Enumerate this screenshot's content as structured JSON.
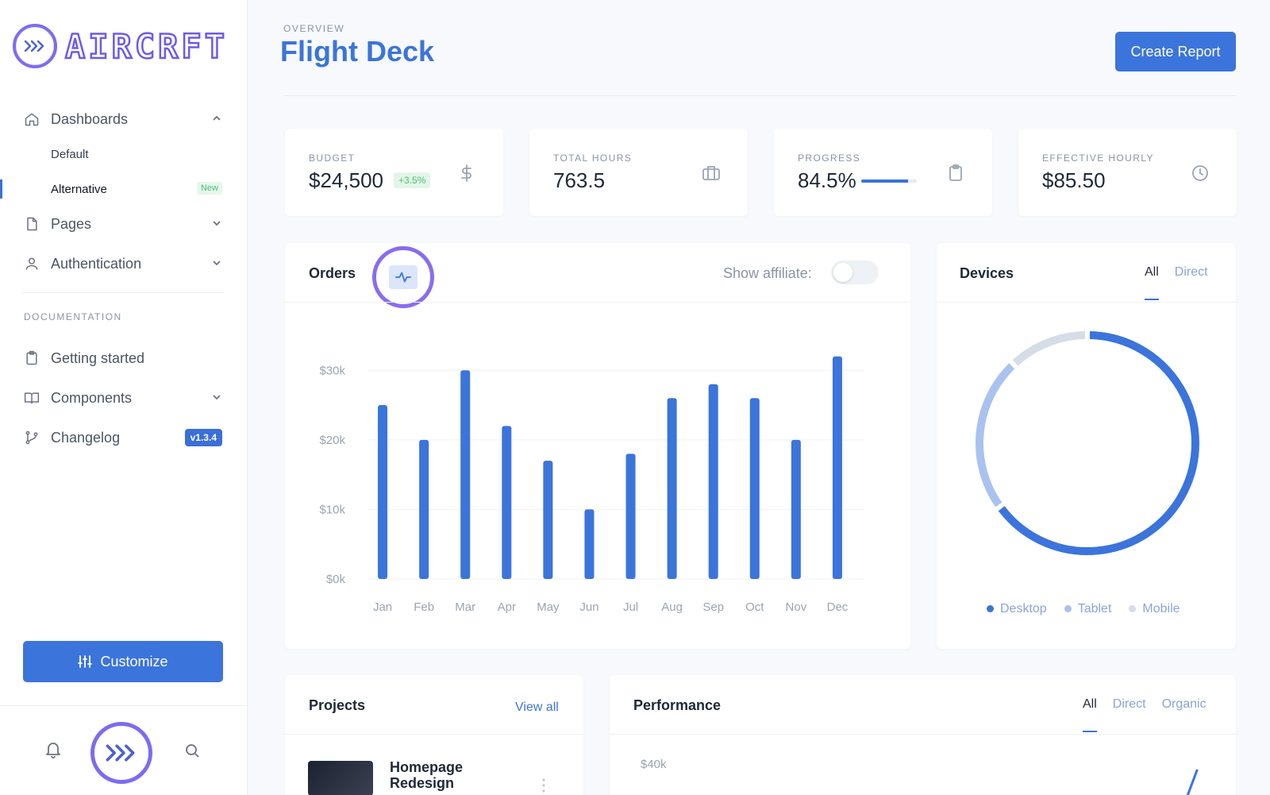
{
  "app": {
    "logo_text": "AIRCRFT"
  },
  "sidebar": {
    "nav": [
      {
        "label": "Dashboards",
        "icon": "home-icon",
        "expanded": true
      },
      {
        "label": "Pages",
        "icon": "file-icon"
      },
      {
        "label": "Authentication",
        "icon": "user-icon"
      }
    ],
    "sub_items": [
      {
        "label": "Default"
      },
      {
        "label": "Alternative",
        "badge": "New",
        "active": true
      }
    ],
    "section_label": "DOCUMENTATION",
    "docs": [
      {
        "label": "Getting started",
        "icon": "clipboard-icon"
      },
      {
        "label": "Components",
        "icon": "book-icon"
      },
      {
        "label": "Changelog",
        "icon": "git-branch-icon",
        "badge": "v1.3.4"
      }
    ],
    "customize_label": "Customize"
  },
  "header": {
    "overline": "OVERVIEW",
    "title": "Flight Deck",
    "create_label": "Create Report"
  },
  "stats": [
    {
      "label": "BUDGET",
      "value": "$24,500",
      "delta": "+3.5%",
      "icon": "dollar-icon"
    },
    {
      "label": "TOTAL HOURS",
      "value": "763.5",
      "icon": "briefcase-icon"
    },
    {
      "label": "PROGRESS",
      "value": "84.5%",
      "progress": 0.845,
      "icon": "clipboard-icon"
    },
    {
      "label": "EFFECTIVE HOURLY",
      "value": "$85.50",
      "icon": "clock-icon"
    }
  ],
  "orders": {
    "title": "Orders",
    "affiliate_label": "Show affiliate:",
    "affiliate_on": false
  },
  "devices": {
    "title": "Devices",
    "tabs": [
      "All",
      "Direct"
    ],
    "active_tab": "All",
    "legend": [
      "Desktop",
      "Tablet",
      "Mobile"
    ],
    "colors": [
      "#3b74db",
      "#a9c2f0",
      "#d6dde9"
    ]
  },
  "projects": {
    "title": "Projects",
    "view_all": "View all",
    "items": [
      {
        "name": "Homepage Redesign"
      }
    ]
  },
  "performance": {
    "title": "Performance",
    "tabs": [
      "All",
      "Direct",
      "Organic"
    ],
    "active_tab": "All",
    "y_tick_top": "$40k"
  },
  "chart_data": [
    {
      "type": "bar",
      "title": "Orders",
      "categories": [
        "Jan",
        "Feb",
        "Mar",
        "Apr",
        "May",
        "Jun",
        "Jul",
        "Aug",
        "Sep",
        "Oct",
        "Nov",
        "Dec"
      ],
      "values": [
        25000,
        20000,
        30000,
        22000,
        17000,
        10000,
        18000,
        26000,
        28000,
        26000,
        20000,
        32000
      ],
      "ylim": [
        0,
        33000
      ],
      "y_ticks": [
        "$0k",
        "$10k",
        "$20k",
        "$30k"
      ],
      "y_tick_values": [
        0,
        10000,
        20000,
        30000
      ],
      "color": "#3b74db",
      "grid": true
    },
    {
      "type": "pie",
      "title": "Devices",
      "labels": [
        "Desktop",
        "Tablet",
        "Mobile"
      ],
      "values": [
        65,
        23,
        12
      ],
      "colors": [
        "#3b74db",
        "#a9c2f0",
        "#d6dde9"
      ]
    }
  ]
}
